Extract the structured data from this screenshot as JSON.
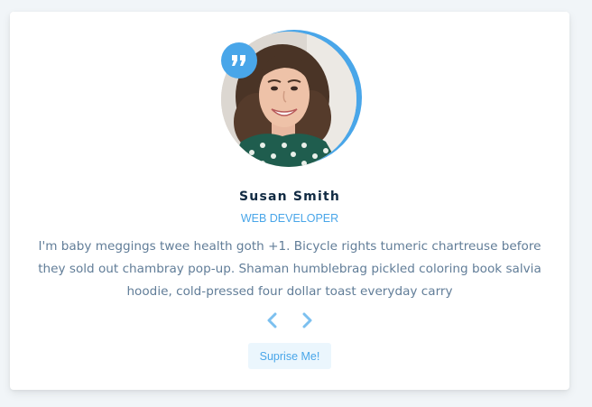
{
  "review": {
    "name": "Susan Smith",
    "job": "WEB DEVELOPER",
    "text": "I'm baby meggings twee health goth +1. Bicycle rights tumeric chartreuse before they sold out chambray pop-up. Shaman humblebrag pickled coloring book salvia hoodie, cold-pressed four dollar toast everyday carry"
  },
  "controls": {
    "prev_icon": "chevron-left-icon",
    "next_icon": "chevron-right-icon",
    "random_label": "Suprise Me!"
  },
  "icons": {
    "quote": "quote-icon"
  },
  "colors": {
    "accent": "#49a6e9",
    "title": "#102a42",
    "text": "#617d98",
    "background": "#f1f5f8",
    "button_bg": "#ebf6fd"
  }
}
